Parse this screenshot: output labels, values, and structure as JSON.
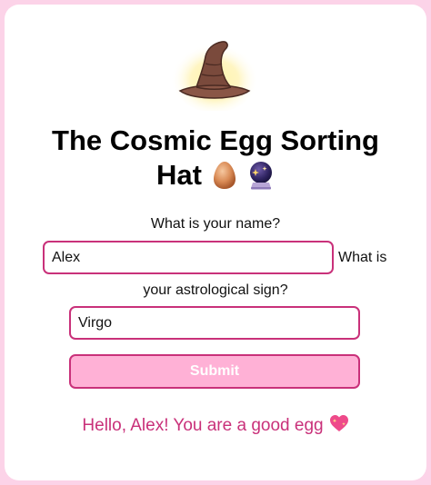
{
  "app": {
    "title_line1": "The Cosmic Egg Sorting",
    "title_line2": "Hat",
    "title_icons": [
      "egg-icon",
      "crystal-ball-icon"
    ],
    "hat_icon": "wizard-hat-icon"
  },
  "form": {
    "name_label": "What is your name?",
    "name_value": "Alex",
    "sign_label_part1": "What is",
    "sign_label_part2": "your astrological sign?",
    "sign_value": "Virgo",
    "submit_label": "Submit"
  },
  "result": {
    "message": "Hello, Alex! You are a good egg",
    "icon": "sparkling-heart-icon"
  },
  "colors": {
    "page_background": "#fcd3e8",
    "accent": "#c9317a",
    "button_fill": "#ffb1d6"
  }
}
